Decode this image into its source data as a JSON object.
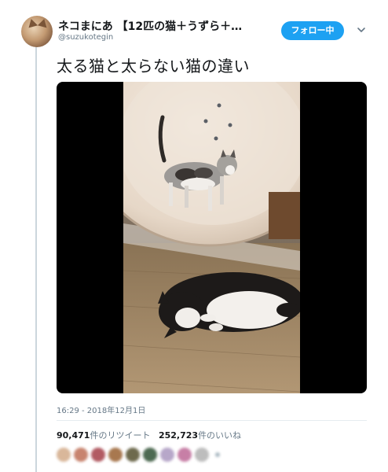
{
  "user": {
    "display_name": "ネコまにあ 【12匹の猫＋うずら＋…",
    "handle": "@suzukotegin"
  },
  "follow_button": {
    "label": "フォロー中"
  },
  "tweet": {
    "text": "太る猫と太らない猫の違い",
    "timestamp": "16:29 - 2018年12月1日"
  },
  "stats": {
    "retweets_count": "90,471",
    "retweets_label": "件のリツイート",
    "likes_count": "252,723",
    "likes_label": "件のいいね"
  },
  "likers": {
    "colors": [
      "#d9b79a",
      "#c8846f",
      "#b25b63",
      "#a8784f",
      "#6e6a4d",
      "#4d6a52",
      "#b7a7c9",
      "#c77fa6",
      "#bdbdbd"
    ]
  },
  "colors": {
    "accent": "#1da1f2",
    "text_primary": "#14171a",
    "text_secondary": "#657786"
  }
}
